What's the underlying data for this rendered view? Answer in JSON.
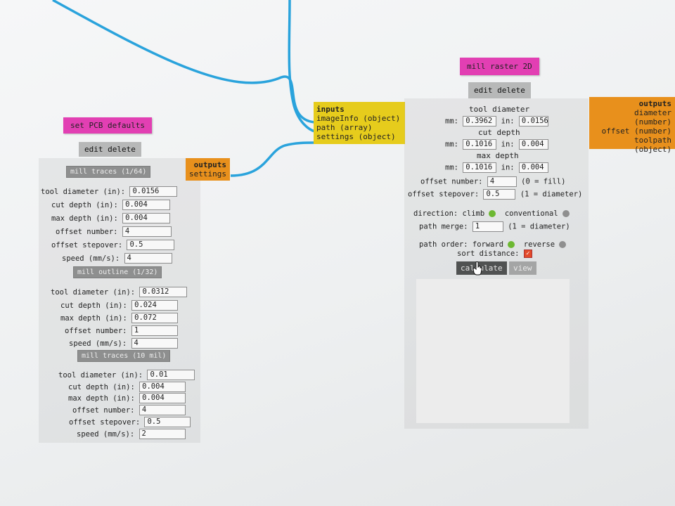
{
  "pcb_defaults": {
    "title": "set PCB defaults",
    "edit_delete": "edit delete",
    "sections": [
      {
        "button": "mill traces (1/64)",
        "fields": [
          {
            "label": "tool diameter (in):",
            "value": "0.0156"
          },
          {
            "label": "cut depth (in):",
            "value": "0.004"
          },
          {
            "label": "max depth (in):",
            "value": "0.004"
          },
          {
            "label": "offset number:",
            "value": "4"
          },
          {
            "label": "offset stepover:",
            "value": "0.5"
          },
          {
            "label": "speed (mm/s):",
            "value": "4"
          }
        ]
      },
      {
        "button": "mill outline (1/32)",
        "fields": [
          {
            "label": "tool diameter (in):",
            "value": "0.0312"
          },
          {
            "label": "cut depth (in):",
            "value": "0.024"
          },
          {
            "label": "max depth (in):",
            "value": "0.072"
          },
          {
            "label": "offset number:",
            "value": "1"
          },
          {
            "label": "speed (mm/s):",
            "value": "4"
          }
        ]
      },
      {
        "button": "mill traces (10 mil)",
        "fields": [
          {
            "label": "tool diameter (in):",
            "value": "0.01"
          },
          {
            "label": "cut depth (in):",
            "value": "0.004"
          },
          {
            "label": "max depth (in):",
            "value": "0.004"
          },
          {
            "label": "offset number:",
            "value": "4"
          },
          {
            "label": "offset stepover:",
            "value": "0.5"
          },
          {
            "label": "speed (mm/s):",
            "value": "2"
          }
        ]
      }
    ],
    "outputs": {
      "header": "outputs",
      "items": [
        "settings"
      ]
    }
  },
  "inputs_node": {
    "header": "inputs",
    "items": [
      "imageInfo (object)",
      "path (array)",
      "settings (object)"
    ]
  },
  "mill_raster": {
    "title": "mill raster 2D",
    "edit_delete": "edit delete",
    "tool_diameter": {
      "heading": "tool diameter",
      "mm_label": "mm:",
      "mm_value": "0.3962",
      "in_label": "in:",
      "in_value": "0.0156"
    },
    "cut_depth": {
      "heading": "cut depth",
      "mm_label": "mm:",
      "mm_value": "0.1016",
      "in_label": "in:",
      "in_value": "0.004"
    },
    "max_depth": {
      "heading": "max depth",
      "mm_label": "mm:",
      "mm_value": "0.1016",
      "in_label": "in:",
      "in_value": "0.004"
    },
    "offset_number": {
      "label": "offset number:",
      "value": "4",
      "hint": "(0 = fill)"
    },
    "offset_stepover": {
      "label": "offset stepover:",
      "value": "0.5",
      "hint": "(1 = diameter)"
    },
    "direction": {
      "label": "direction:",
      "option_a": "climb",
      "option_b": "conventional"
    },
    "path_merge": {
      "label": "path merge:",
      "value": "1",
      "hint": "(1 = diameter)"
    },
    "path_order": {
      "label": "path order:",
      "option_a": "forward",
      "option_b": "reverse"
    },
    "sort_distance": {
      "label": "sort distance:",
      "checked": true,
      "check_glyph": "✓"
    },
    "calculate_label": "calculate",
    "view_label": "view"
  },
  "outputs_right": {
    "header": "outputs",
    "items": [
      "diameter (number)",
      "offset (number)",
      "toolpath (object)"
    ]
  },
  "colors": {
    "wire": "#2aa3dc",
    "magenta": "#e23fb3",
    "yellow": "#e6cc1c",
    "orange": "#e8901c",
    "radio_on": "#6db832",
    "radio_off": "#8f8f8f"
  },
  "icons": {
    "cursor": "hand-pointer-icon",
    "radio_on": "green-radio-icon",
    "radio_off": "grey-radio-icon",
    "check": "checkbox-checked-icon"
  }
}
